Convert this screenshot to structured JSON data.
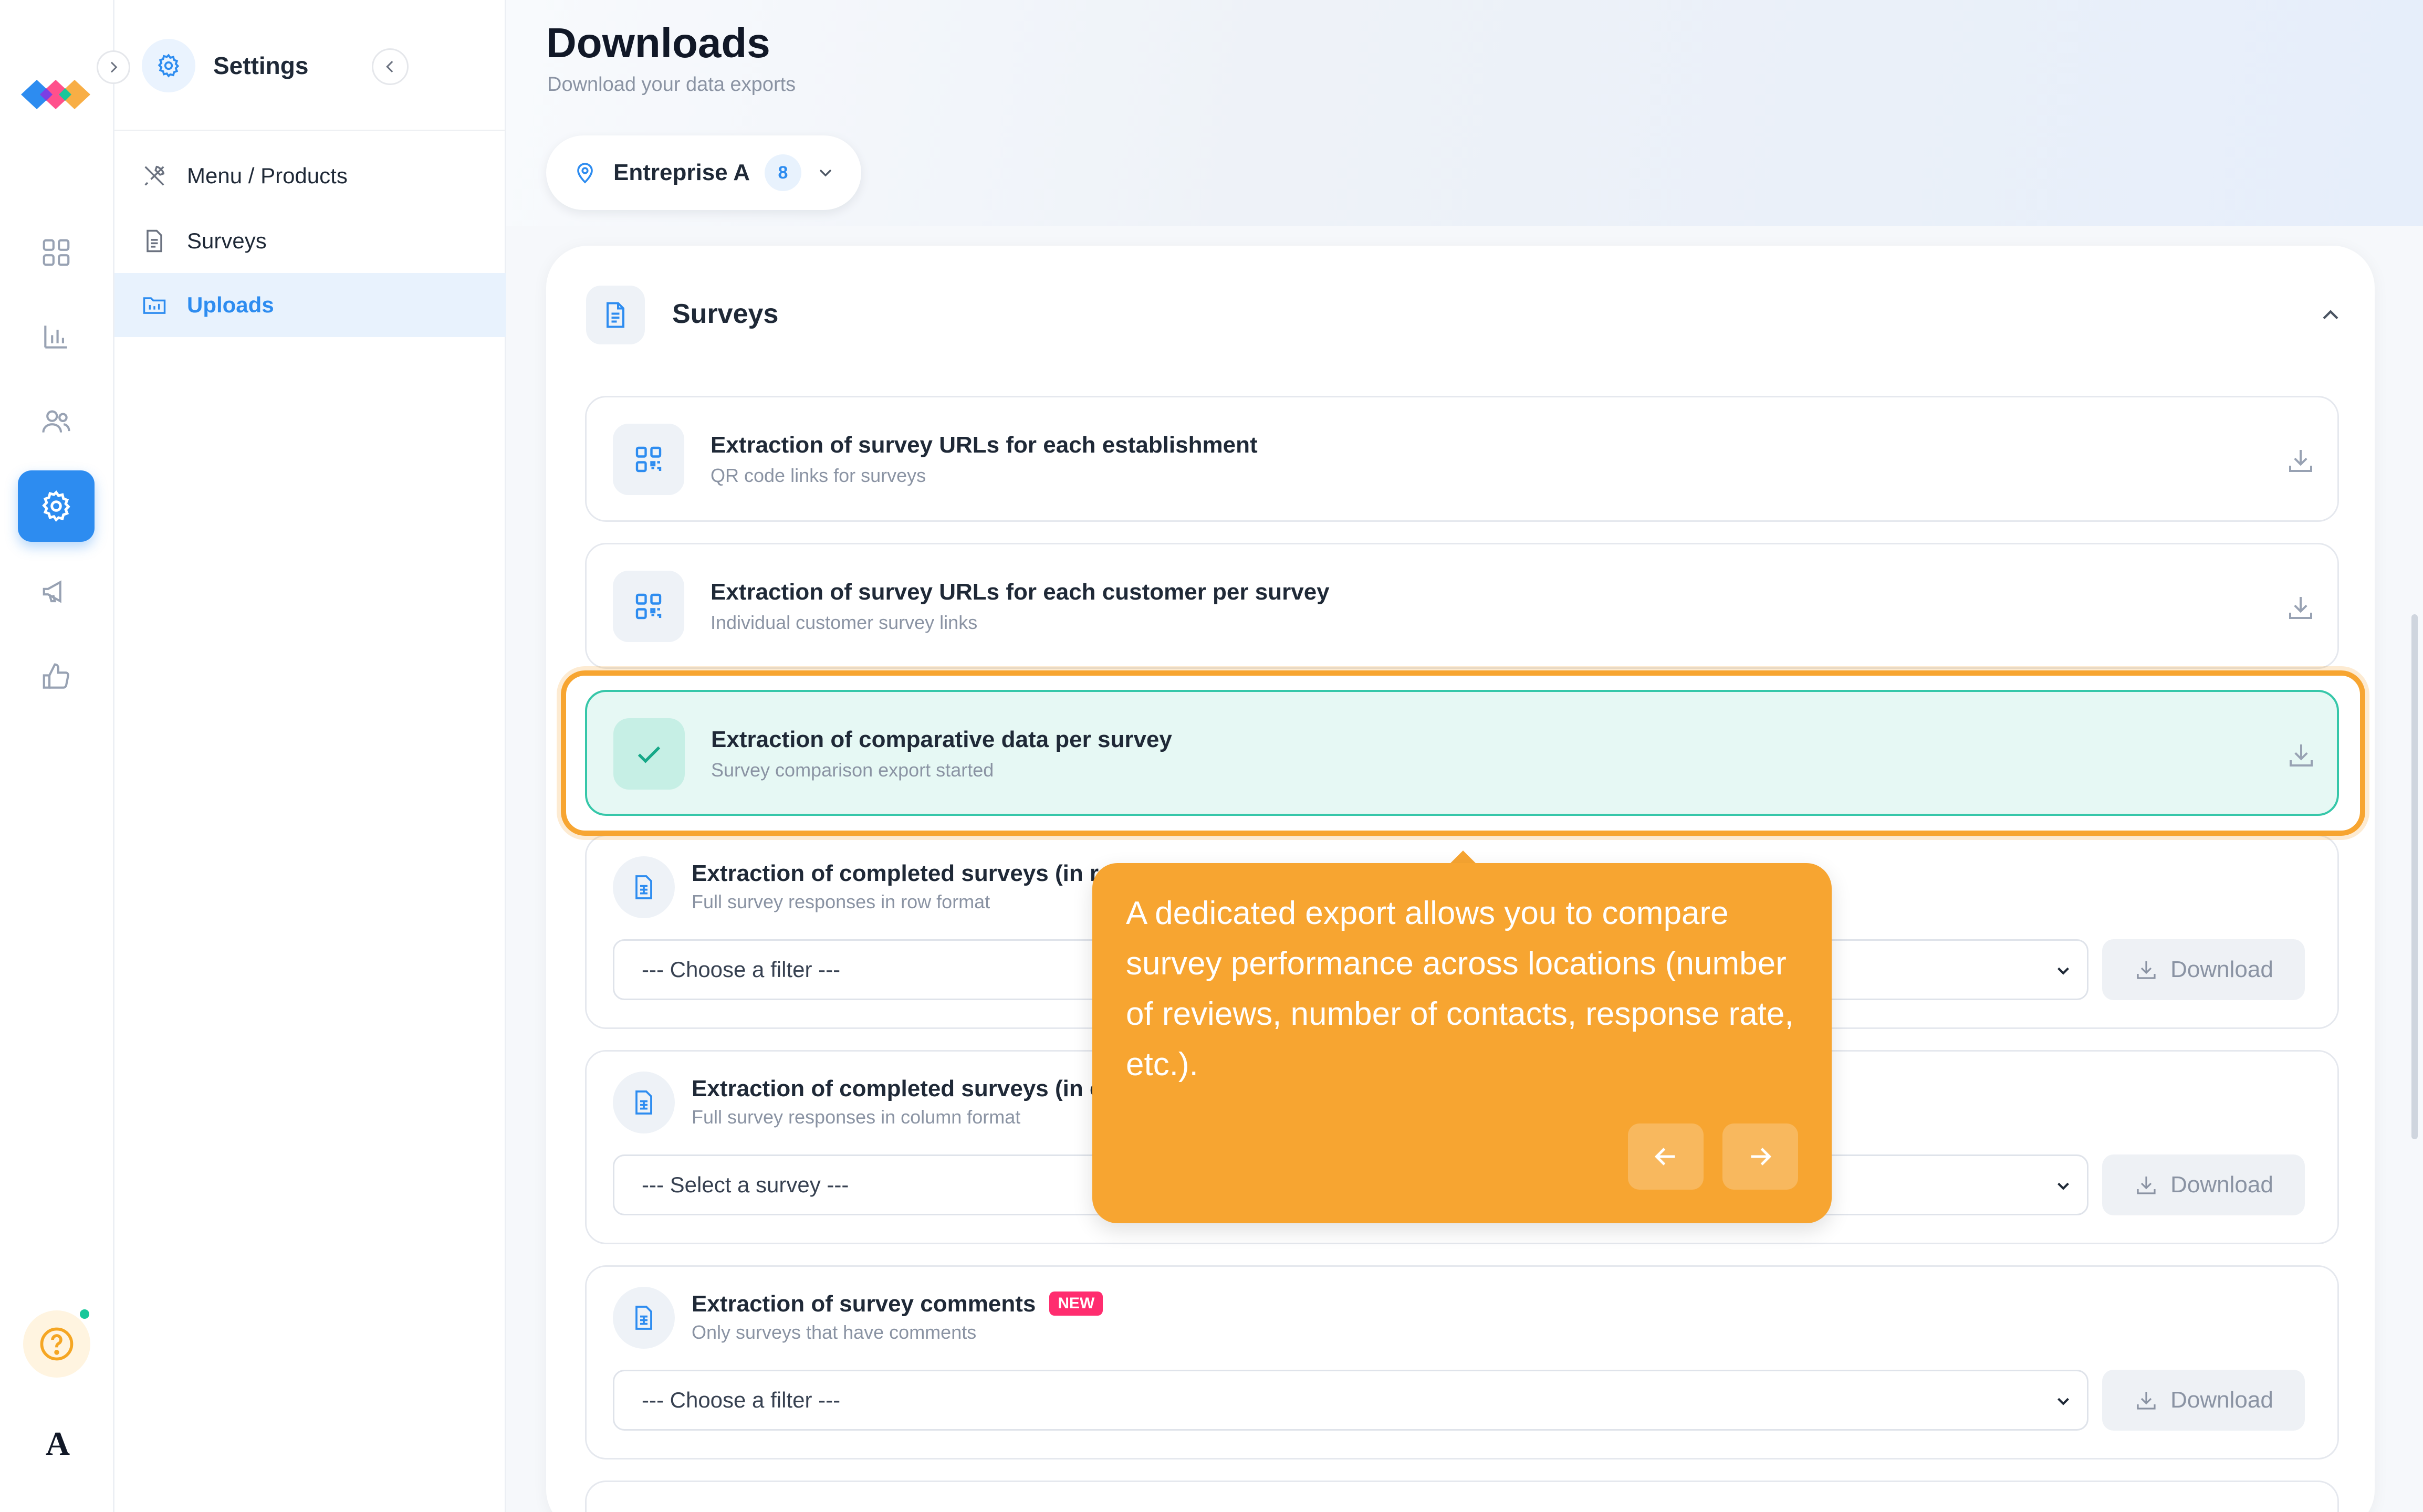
{
  "rail": {
    "items": [
      {
        "name": "dashboard-icon"
      },
      {
        "name": "chart-icon"
      },
      {
        "name": "users-icon"
      },
      {
        "name": "gear-icon",
        "active": true
      },
      {
        "name": "megaphone-icon"
      },
      {
        "name": "thumbs-up-icon"
      }
    ],
    "avatar_letter": "A"
  },
  "settings_panel": {
    "title": "Settings",
    "items": [
      {
        "label": "Menu / Products",
        "icon": "utensils-icon"
      },
      {
        "label": "Surveys",
        "icon": "document-icon"
      },
      {
        "label": "Uploads",
        "icon": "folder-icon",
        "active": true
      }
    ]
  },
  "header": {
    "title": "Downloads",
    "subtitle": "Download your data exports"
  },
  "enterprise": {
    "name": "Entreprise A",
    "count": "8"
  },
  "section": {
    "title": "Surveys",
    "rows": [
      {
        "title": "Extraction of survey URLs for each establishment",
        "subtitle": "QR code links for surveys"
      },
      {
        "title": "Extraction of survey URLs for each customer per survey",
        "subtitle": "Individual customer survey links"
      },
      {
        "title": "Extraction of comparative data per survey",
        "subtitle": "Survey comparison export started"
      },
      {
        "title": "Extraction of completed surveys (in r",
        "subtitle": "Full survey responses in row format",
        "select": "--- Choose a filter ---",
        "button": "Download"
      },
      {
        "title": "Extraction of completed surveys (in c",
        "subtitle": "Full survey responses in column format",
        "select": "--- Select a survey ---",
        "button": "Download"
      },
      {
        "title": "Extraction of survey comments",
        "badge": "NEW",
        "subtitle": "Only surveys that have comments",
        "select": "--- Choose a filter ---",
        "button": "Download"
      }
    ]
  },
  "tooltip": {
    "text": "A dedicated export allows you to compare survey performance across locations (number of reviews, number of contacts, response rate, etc.)."
  },
  "colors": {
    "accent": "#2d8cf0",
    "tooltip": "#f7a531",
    "success": "#36c7a9",
    "badge": "#ff2d6f"
  }
}
